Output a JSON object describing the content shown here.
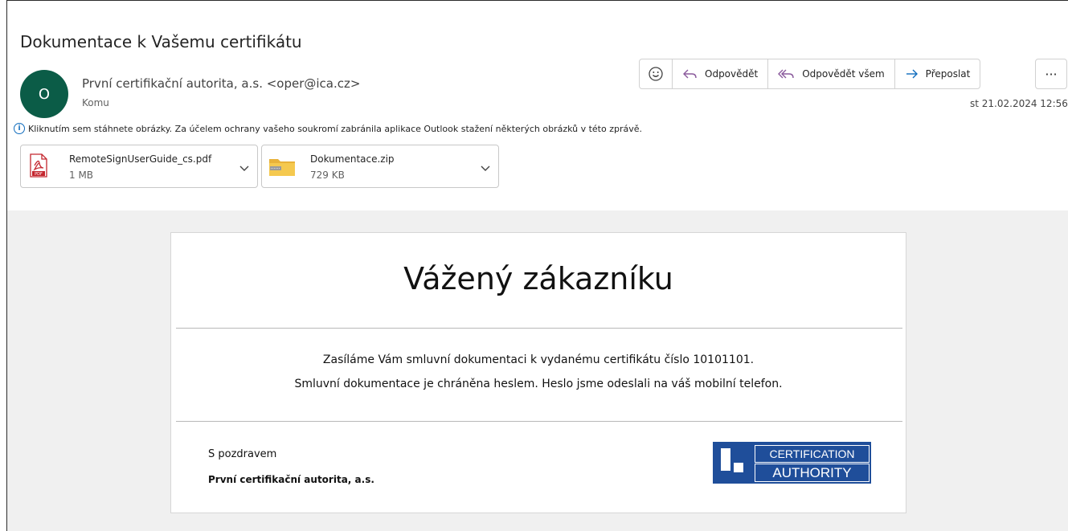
{
  "email": {
    "subject": "Dokumentace k Vašemu certifikátu",
    "sender_initial": "O",
    "sender": "První certifikační autorita, a.s. <oper@ica.cz>",
    "to_label": "Komu",
    "date": "st 21.02.2024 12:56"
  },
  "toolbar": {
    "reply": "Odpovědět",
    "reply_all": "Odpovědět všem",
    "forward": "Přeposlat",
    "more": "···"
  },
  "info_bar": {
    "text": "Kliknutím sem stáhnete obrázky. Za účelem ochrany vašeho soukromí zabránila aplikace Outlook stažení některých obrázků v této zprávě."
  },
  "attachments": [
    {
      "name": "RemoteSignUserGuide_cs.pdf",
      "size": "1 MB",
      "icon": "pdf-icon"
    },
    {
      "name": "Dokumentace.zip",
      "size": "729 KB",
      "icon": "zip-folder-icon"
    }
  ],
  "body": {
    "greeting": "Vážený zákazníku",
    "line1": "Zasíláme Vám smluvní dokumentaci k vydanému certifikátu číslo 10101101.",
    "line2": "Smluvní dokumentace je chráněna heslem. Heslo jsme odeslali na váš mobilní telefon.",
    "regards": "S pozdravem",
    "company": "První certifikační autorita, a.s.",
    "logo_line1": "CERTIFICATION",
    "logo_line2": "AUTHORITY"
  },
  "colors": {
    "avatar": "#0b5c47",
    "accent": "#0f6cbd",
    "logo_blue": "#1f4e9a"
  }
}
